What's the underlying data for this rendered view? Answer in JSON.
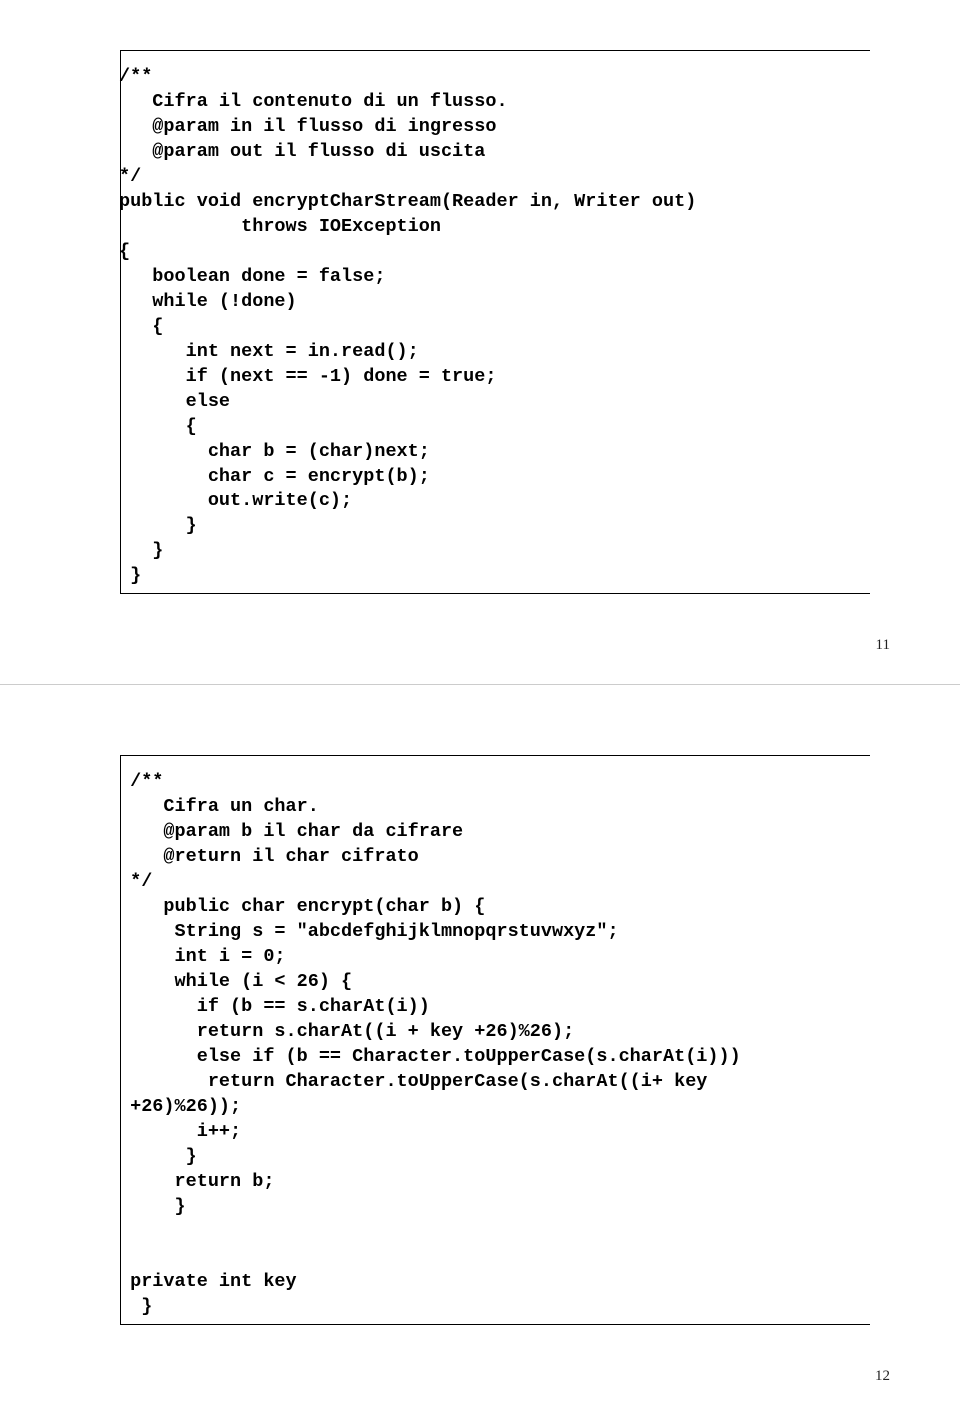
{
  "pages": [
    {
      "code": "/**\n   Cifra il contenuto di un flusso.\n   @param in il flusso di ingresso\n   @param out il flusso di uscita\n*/\npublic void encryptCharStream(Reader in, Writer out)\n           throws IOException\n{\n   boolean done = false;\n   while (!done)\n   {\n      int next = in.read();\n      if (next == -1) done = true;\n      else\n      {\n        char b = (char)next;\n        char c = encrypt(b);\n        out.write(c);\n      }\n   }\n }",
      "number": "11"
    },
    {
      "code": " /**\n    Cifra un char.\n    @param b il char da cifrare\n    @return il char cifrato\n */\n    public char encrypt(char b) {\n     String s = \"abcdefghijklmnopqrstuvwxyz\";\n     int i = 0;\n     while (i < 26) {\n       if (b == s.charAt(i))\n       return s.charAt((i + key +26)%26);\n       else if (b == Character.toUpperCase(s.charAt(i)))\n        return Character.toUpperCase(s.charAt((i+ key\n +26)%26));\n       i++;\n      }\n     return b;\n     }\n\n\n private int key\n  }",
      "number": "12"
    }
  ]
}
